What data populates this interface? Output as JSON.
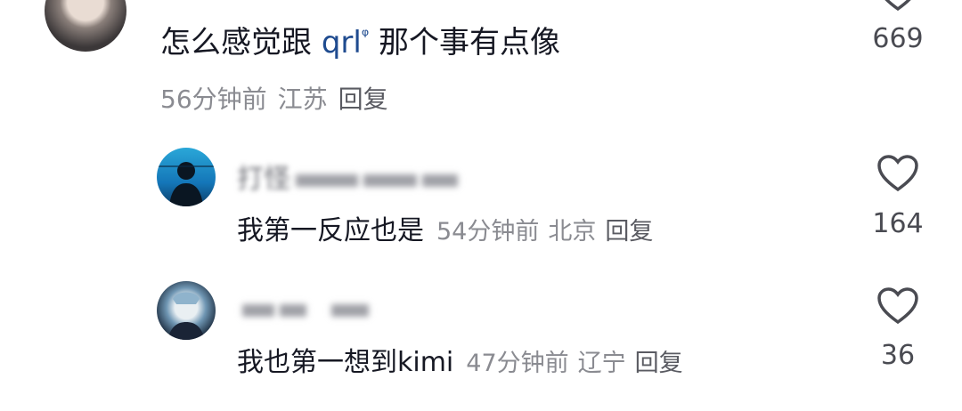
{
  "top_comment": {
    "text_before": "怎么感觉跟 ",
    "mention": "qrl",
    "mention_mark": "ᵠ",
    "text_after": " 那个事有点像",
    "time": "56分钟前",
    "location": "江苏",
    "reply_label": "回复",
    "like_count": "669"
  },
  "replies": [
    {
      "username": "打怪",
      "text": "我第一反应也是",
      "time": "54分钟前",
      "location": "北京",
      "reply_label": "回复",
      "like_count": "164"
    },
    {
      "username": "",
      "text": "我也第一想到kimi",
      "time": "47分钟前",
      "location": "辽宁",
      "reply_label": "回复",
      "like_count": "36"
    }
  ],
  "icons": {
    "like": "heart-outline-icon"
  },
  "colors": {
    "text": "#161823",
    "meta": "#8a8b91",
    "mention": "#1f4b8f"
  }
}
